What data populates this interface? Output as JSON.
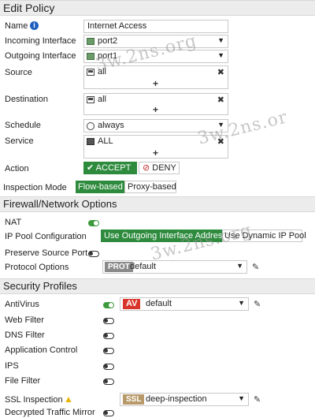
{
  "header": {
    "title": "Edit Policy"
  },
  "form": {
    "name_label": "Name",
    "name_value": "Internet Access",
    "incoming_label": "Incoming Interface",
    "incoming_value": "port2",
    "outgoing_label": "Outgoing Interface",
    "outgoing_value": "port1",
    "source_label": "Source",
    "source_value": "all",
    "destination_label": "Destination",
    "destination_value": "all",
    "schedule_label": "Schedule",
    "schedule_value": "always",
    "service_label": "Service",
    "service_value": "ALL",
    "action_label": "Action",
    "accept_label": "ACCEPT",
    "deny_label": "DENY",
    "inspection_label": "Inspection Mode",
    "flow_label": "Flow-based",
    "proxy_label": "Proxy-based"
  },
  "firewall": {
    "title": "Firewall/Network Options",
    "nat_label": "NAT",
    "nat_on": true,
    "ippool_label": "IP Pool Configuration",
    "use_outgoing_label": "Use Outgoing Interface Address",
    "use_dynamic_label": "Use Dynamic IP Pool",
    "preserve_label": "Preserve Source Port",
    "preserve_on": false,
    "protocol_label": "Protocol Options",
    "protocol_badge": "PROT",
    "protocol_value": "default"
  },
  "security": {
    "title": "Security Profiles",
    "antivirus_label": "AntiVirus",
    "antivirus_badge": "AV",
    "antivirus_value": "default",
    "webfilter_label": "Web Filter",
    "dnsfilter_label": "DNS Filter",
    "appcontrol_label": "Application Control",
    "ips_label": "IPS",
    "filefilter_label": "File Filter",
    "ssl_label": "SSL Inspection",
    "ssl_badge": "SSL",
    "ssl_value": "deep-inspection",
    "mirror_label": "Decrypted Traffic Mirror"
  },
  "watermark": {
    "text1": "3w.2ns.org",
    "text2": "3w.2ns.or",
    "text3": "3w.2ns.org"
  },
  "colors": {
    "accept_green": "#2e8b3e",
    "deny_red": "#c0282c",
    "av_red": "#d9342b",
    "ssl_tan": "#b89a6a",
    "prot_gray": "#8a8a8a",
    "info_blue": "#1f5fbf",
    "warn_yellow": "#e8b400"
  }
}
